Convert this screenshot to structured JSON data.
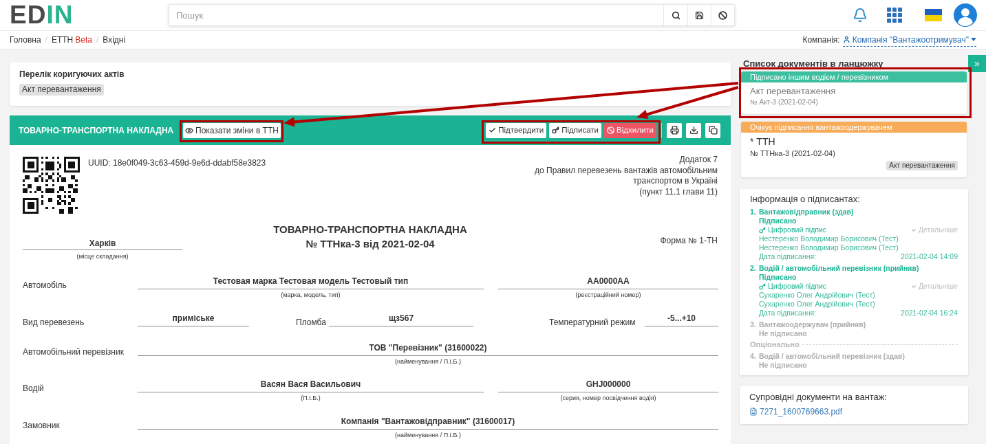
{
  "logo": {
    "dark": "ED",
    "accent": "IN"
  },
  "search": {
    "placeholder": "Пошук"
  },
  "breadcrumb": {
    "separator": "/",
    "items": [
      {
        "label": "Головна"
      },
      {
        "label": "ЕТТН",
        "tag": "Beta"
      },
      {
        "label": "Вхідні"
      }
    ]
  },
  "company": {
    "label": "Компанія:",
    "name": "Компанія \"Вантажоотримувач\""
  },
  "corrective_acts": {
    "title": "Перелік коригуючих актів",
    "tags": [
      "Акт перевантаження"
    ]
  },
  "document_header": {
    "title": "ТОВАРНО-ТРАНСПОРТНА НАКЛАДНА",
    "show_changes": "Показати зміни в ТТН",
    "actions": [
      {
        "label": "Підтвердити",
        "kind": "confirm"
      },
      {
        "label": "Підписати",
        "kind": "sign"
      },
      {
        "label": "Відхилити",
        "kind": "reject"
      }
    ],
    "tools": [
      {
        "kind": "print"
      },
      {
        "kind": "download"
      },
      {
        "kind": "copy"
      }
    ]
  },
  "document": {
    "uuid": "UUID: 18e0f049-3c63-459d-9e6d-ddabf58e3823",
    "appendix": [
      "Додаток 7",
      "до Правил перевезень вантажів автомобільним",
      "транспортом в Україні",
      "(пункт 11.1 глави 11)"
    ],
    "title": "ТОВАРНО-ТРАНСПОРТНА НАКЛАДНА",
    "number": "№ ТТНка-3 від 2021-02-04",
    "place": {
      "value": "Харків",
      "caption": "(місце складання)"
    },
    "form": "Форма № 1-ТН",
    "rows": [
      {
        "kind": "pair",
        "label": "Автомобіль",
        "fields": [
          {
            "value": "Тестовая марка Тестовая модель Тестовый тип",
            "caption": "(марка, модель, тип)"
          },
          {
            "value": "АА0000АА",
            "caption": "(реєстраційний номер)"
          }
        ]
      },
      {
        "kind": "triple",
        "cells": [
          {
            "label": "Вид перевезень",
            "value": "приміське"
          },
          {
            "label": "Пломба",
            "value": "щз567"
          },
          {
            "label": "Температурний режим",
            "value": "-5...+10"
          }
        ]
      },
      {
        "kind": "wide",
        "label": "Автомобільний перевізник",
        "fields": [
          {
            "value": "ТОВ \"Перевізник\" (31600022)",
            "caption": "(найменування / П.І.Б.)"
          }
        ]
      },
      {
        "kind": "pair",
        "label": "Водій",
        "fields": [
          {
            "value": "Васян Вася Васильович",
            "caption": "(П.І.Б.)"
          },
          {
            "value": "GHJ000000",
            "caption": "(серия, номер посвідчення водія)"
          }
        ]
      },
      {
        "kind": "wide",
        "label": "Замовник",
        "fields": [
          {
            "value": "Компанія \"Вантажовідправник\" (31600017)",
            "caption": "(найменування / П.І.Б.)"
          }
        ]
      }
    ]
  },
  "expand_button": "»",
  "chain": {
    "title": "Список документів в ланцюжку",
    "cards": [
      {
        "kind": "signed",
        "status": "Підписано іншим водієм / перевізником",
        "title": "Акт перевантаження",
        "number": "№ Акт-3 (2021-02-04)",
        "current": false
      },
      {
        "kind": "pending",
        "status": "Очікує підписання вантажоодержувачем",
        "title": "* ТТН",
        "number": "№ ТТНка-3 (2021-02-04)",
        "current": true,
        "tags": [
          "Акт перевантаження"
        ]
      }
    ]
  },
  "signers": {
    "title": "Інформація о підписантах:",
    "items": [
      {
        "kind": "signer",
        "number": "1.",
        "role": "Вантажовідправник (здав)",
        "status": "Підписано",
        "signed": true,
        "signature": "Цифровий підпис",
        "details": "Детальніше",
        "names": [
          "Нестеренко Володимир Борисович (Тест)",
          "Нестеренко Володимир Борисович (Тест)"
        ],
        "date_label": "Дата підписання:",
        "date": "2021-02-04 14:09"
      },
      {
        "kind": "signer",
        "number": "2.",
        "role": "Водій / автомобільний перевізник (прийняв)",
        "status": "Підписано",
        "signed": true,
        "signature": "Цифровий підпис",
        "details": "Детальніше",
        "names": [
          "Сухаренко Олег Андрійович (Тест)",
          "Сухаренко Олег Андрійович (Тест)"
        ],
        "date_label": "Дата підписання:",
        "date": "2021-02-04 16:24"
      },
      {
        "kind": "signer",
        "number": "3.",
        "role": "Вантажоодержувач (прийняв)",
        "status": "Не підписано",
        "signed": false
      },
      {
        "kind": "divider",
        "label": "Опціонально"
      },
      {
        "kind": "signer",
        "number": "4.",
        "role": "Водій / автомобільний перевізник (здав)",
        "status": "Не підписано",
        "signed": false
      }
    ]
  },
  "attachments": {
    "title": "Супровідні документи на вантаж:",
    "files": [
      "7271_1600769663.pdf"
    ]
  }
}
